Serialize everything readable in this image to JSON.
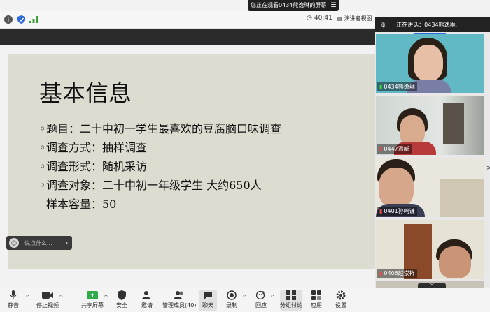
{
  "banner": {
    "text": "您正在观看0434熊逸琳的屏幕"
  },
  "status": {
    "time": "40:41",
    "presenter_view": "演讲者视图"
  },
  "speaker": {
    "text": "正在讲话：0434熊逸琳;"
  },
  "slide": {
    "title": "基本信息",
    "bullets": [
      {
        "text": "题目：二十中初一学生最喜欢的豆腐脑口味调查"
      },
      {
        "text": "调查方式：抽样调查"
      },
      {
        "text": "调查形式：随机采访"
      },
      {
        "text": "调查对象：二十中初一年级学生 大约650人"
      }
    ],
    "sub_line": "样本容量：50"
  },
  "chat": {
    "placeholder": "说点什么..."
  },
  "participants": [
    {
      "name": "0434熊逸琳",
      "mic": "on"
    },
    {
      "name": "0447温昕",
      "mic": "muted"
    },
    {
      "name": "0401孙鸣谦",
      "mic": "muted"
    },
    {
      "name": "0406赵崇祥",
      "mic": "muted"
    }
  ],
  "toolbar": {
    "mute": "静音",
    "stop_video": "停止视频",
    "share": "共享屏幕",
    "security": "安全",
    "invite": "邀请",
    "participants": "管理成员(40)",
    "chat": "聊天",
    "record": "录制",
    "reactions": "回应",
    "breakout": "分组讨论",
    "apps": "应用",
    "settings": "设置"
  },
  "colors": {
    "slide_bg": "#dddcd0",
    "accent": "#2e6bd8",
    "mic_on": "#3fdc3f",
    "mic_muted": "#e84a4a"
  }
}
